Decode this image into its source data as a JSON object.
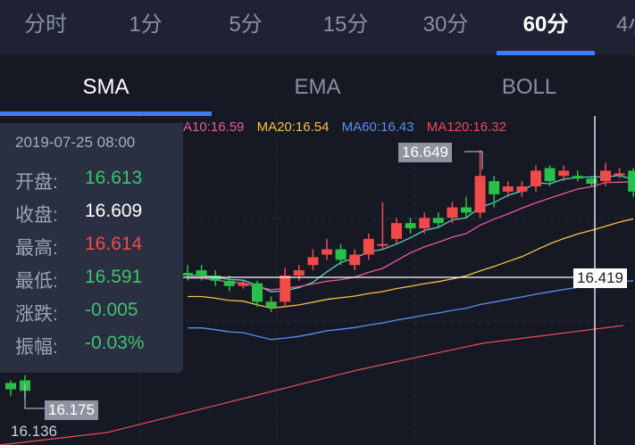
{
  "period_tabs": [
    {
      "label": "分时",
      "active": false
    },
    {
      "label": "1分",
      "active": false
    },
    {
      "label": "5分",
      "active": false
    },
    {
      "label": "15分",
      "active": false
    },
    {
      "label": "30分",
      "active": false
    },
    {
      "label": "60分",
      "active": true
    },
    {
      "label": "4小",
      "active": false
    }
  ],
  "indicator_tabs": [
    {
      "label": "SMA",
      "active": true
    },
    {
      "label": "EMA",
      "active": false
    },
    {
      "label": "BOLL",
      "active": false
    }
  ],
  "ma_legend": [
    {
      "text": "A10:16.59",
      "color": "#e8599a"
    },
    {
      "text": "MA20:16.54",
      "color": "#f5c142"
    },
    {
      "text": "MA60:16.43",
      "color": "#5b8def"
    },
    {
      "text": "MA120:16.32",
      "color": "#e84b5a"
    }
  ],
  "info_panel": {
    "date": "2019-07-25 08:00",
    "rows": [
      {
        "label": "开盘:",
        "value": "16.613",
        "color": "#3cc46a"
      },
      {
        "label": "收盘:",
        "value": "16.609",
        "color": "#ffffff"
      },
      {
        "label": "最高:",
        "value": "16.614",
        "color": "#f04a4a"
      },
      {
        "label": "最低:",
        "value": "16.591",
        "color": "#3cc46a"
      },
      {
        "label": "涨跌:",
        "value": "-0.005",
        "color": "#3cc46a"
      },
      {
        "label": "振幅:",
        "value": "-0.03%",
        "color": "#3cc46a"
      }
    ]
  },
  "price_labels": {
    "high_marker": "16.649",
    "crosshair_price": "16.419",
    "low_marker": "16.175",
    "axis_min": "16.136"
  },
  "colors": {
    "up": "#f04a4a",
    "down": "#28c04a",
    "accent": "#3f7bf6",
    "ma10": "#e8599a",
    "ma20": "#f5c142",
    "ma60": "#5b8def",
    "ma120": "#e84b5a"
  },
  "chart_data": {
    "type": "candlestick",
    "ylim": [
      16.136,
      16.66
    ],
    "candles": [
      {
        "o": 16.205,
        "c": 16.193,
        "h": 16.21,
        "l": 16.18
      },
      {
        "o": 16.21,
        "c": 16.19,
        "h": 16.22,
        "l": 16.175
      },
      {
        "o": 16.415,
        "c": 16.41,
        "h": 16.43,
        "l": 16.4
      },
      {
        "o": 16.42,
        "c": 16.41,
        "h": 16.43,
        "l": 16.4
      },
      {
        "o": 16.41,
        "c": 16.4,
        "h": 16.42,
        "l": 16.39
      },
      {
        "o": 16.4,
        "c": 16.39,
        "h": 16.41,
        "l": 16.38
      },
      {
        "o": 16.39,
        "c": 16.395,
        "h": 16.4,
        "l": 16.385
      },
      {
        "o": 16.395,
        "c": 16.36,
        "h": 16.4,
        "l": 16.35
      },
      {
        "o": 16.36,
        "c": 16.35,
        "h": 16.37,
        "l": 16.34
      },
      {
        "o": 16.36,
        "c": 16.41,
        "h": 16.425,
        "l": 16.35
      },
      {
        "o": 16.41,
        "c": 16.42,
        "h": 16.43,
        "l": 16.4
      },
      {
        "o": 16.43,
        "c": 16.445,
        "h": 16.46,
        "l": 16.42
      },
      {
        "o": 16.45,
        "c": 16.46,
        "h": 16.48,
        "l": 16.44
      },
      {
        "o": 16.46,
        "c": 16.44,
        "h": 16.47,
        "l": 16.43
      },
      {
        "o": 16.43,
        "c": 16.45,
        "h": 16.46,
        "l": 16.42
      },
      {
        "o": 16.45,
        "c": 16.48,
        "h": 16.49,
        "l": 16.44
      },
      {
        "o": 16.47,
        "c": 16.47,
        "h": 16.55,
        "l": 16.46
      },
      {
        "o": 16.48,
        "c": 16.51,
        "h": 16.52,
        "l": 16.47
      },
      {
        "o": 16.51,
        "c": 16.5,
        "h": 16.52,
        "l": 16.49
      },
      {
        "o": 16.5,
        "c": 16.52,
        "h": 16.53,
        "l": 16.49
      },
      {
        "o": 16.52,
        "c": 16.51,
        "h": 16.53,
        "l": 16.5
      },
      {
        "o": 16.52,
        "c": 16.54,
        "h": 16.55,
        "l": 16.51
      },
      {
        "o": 16.54,
        "c": 16.53,
        "h": 16.56,
        "l": 16.52
      },
      {
        "o": 16.53,
        "c": 16.6,
        "h": 16.649,
        "l": 16.52
      },
      {
        "o": 16.59,
        "c": 16.565,
        "h": 16.6,
        "l": 16.54
      },
      {
        "o": 16.57,
        "c": 16.58,
        "h": 16.59,
        "l": 16.56
      },
      {
        "o": 16.57,
        "c": 16.58,
        "h": 16.59,
        "l": 16.56
      },
      {
        "o": 16.58,
        "c": 16.61,
        "h": 16.62,
        "l": 16.57
      },
      {
        "o": 16.615,
        "c": 16.59,
        "h": 16.62,
        "l": 16.58
      },
      {
        "o": 16.6,
        "c": 16.61,
        "h": 16.62,
        "l": 16.59
      },
      {
        "o": 16.6,
        "c": 16.595,
        "h": 16.61,
        "l": 16.59
      },
      {
        "o": 16.595,
        "c": 16.585,
        "h": 16.6,
        "l": 16.58
      },
      {
        "o": 16.59,
        "c": 16.61,
        "h": 16.625,
        "l": 16.58
      },
      {
        "o": 16.605,
        "c": 16.605,
        "h": 16.615,
        "l": 16.595
      },
      {
        "o": 16.61,
        "c": 16.57,
        "h": 16.615,
        "l": 16.56
      }
    ]
  }
}
